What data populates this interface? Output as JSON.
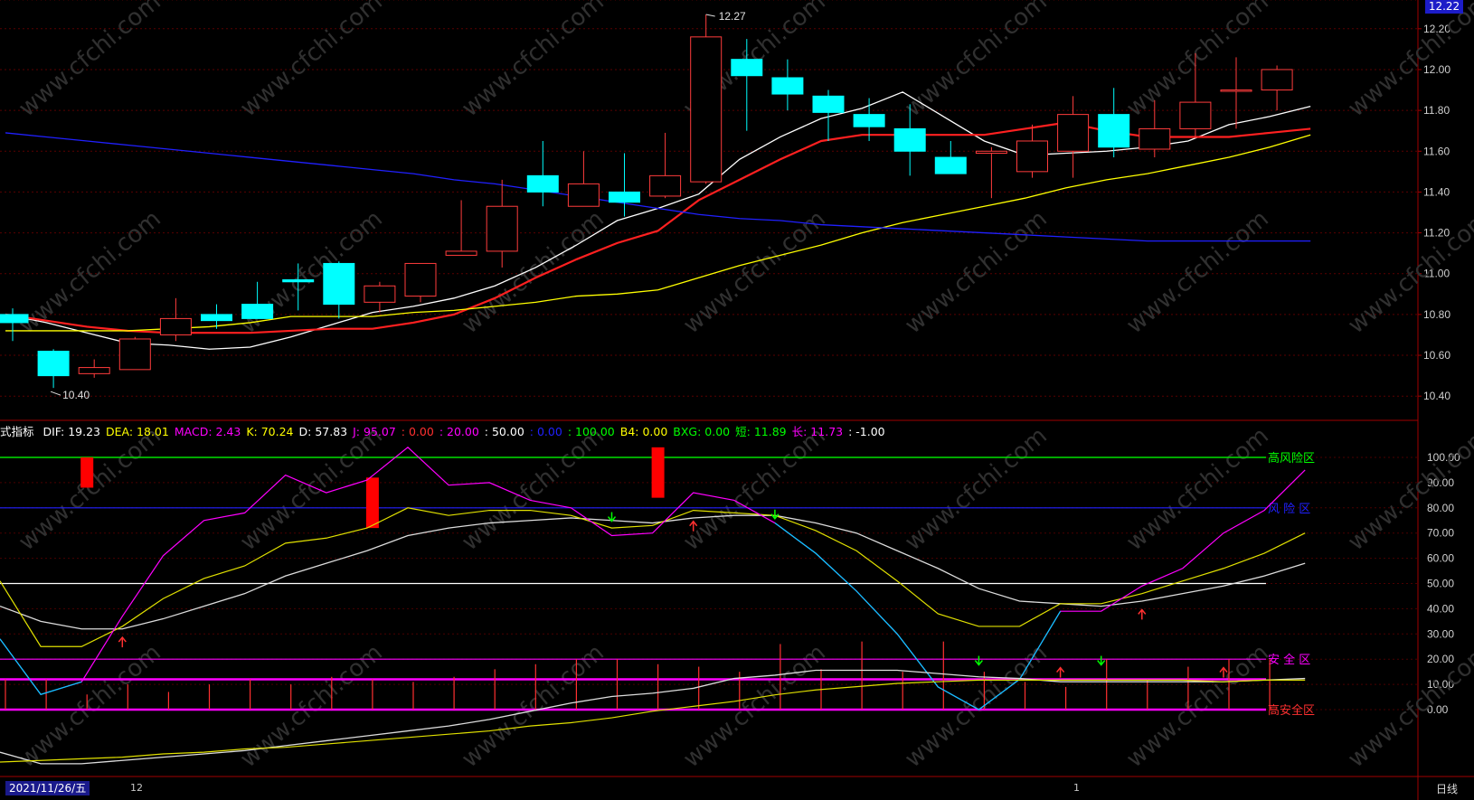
{
  "price_axis": {
    "last_price": "12.22",
    "ticks": [
      "12.20",
      "12.00",
      "11.80",
      "11.60",
      "11.40",
      "11.20",
      "11.00",
      "10.80",
      "10.60",
      "10.40"
    ]
  },
  "indicator_axis": {
    "ticks": [
      "100.00",
      "90.00",
      "80.00",
      "70.00",
      "60.00",
      "50.00",
      "40.00",
      "30.00",
      "20.00",
      "10.00",
      "0.00"
    ]
  },
  "annotations": {
    "high": "12.27",
    "low": "10.40"
  },
  "zones": {
    "high_risk": "高风险区",
    "risk": "风 险 区",
    "safe": "安 全 区",
    "super_safe": "高安全区"
  },
  "indicator_header": {
    "name": "式指标",
    "items": [
      {
        "text": "DIF: 19.23",
        "color": "#ffffff"
      },
      {
        "text": "DEA: 18.01",
        "color": "#ffff00"
      },
      {
        "text": "MACD: 2.43",
        "color": "#ff00ff"
      },
      {
        "text": "K: 70.24",
        "color": "#ffff00"
      },
      {
        "text": "D: 57.83",
        "color": "#ffffff"
      },
      {
        "text": "J: 95.07",
        "color": "#ff00ff"
      },
      {
        "text": ": 0.00",
        "color": "#ff3030"
      },
      {
        "text": ": 20.00",
        "color": "#ff00ff"
      },
      {
        "text": ": 50.00",
        "color": "#ffffff"
      },
      {
        "text": ": 0.00",
        "color": "#2020ff"
      },
      {
        "text": ": 100.00",
        "color": "#00ff00"
      },
      {
        "text": "B4: 0.00",
        "color": "#ffff00"
      },
      {
        "text": "BXG: 0.00",
        "color": "#00ff00"
      },
      {
        "text": "短: 11.89",
        "color": "#00ff00"
      },
      {
        "text": "长: 11.73",
        "color": "#ff00ff"
      },
      {
        "text": ": -1.00",
        "color": "#ffffff"
      }
    ]
  },
  "date_label": "2021/11/26/五",
  "tick_12": "12",
  "tick_1": "1",
  "period_label": "日线",
  "watermark": "www.cfchi.com",
  "colors": {
    "up": "#ff3c3c",
    "down": "#00ffff",
    "ma_short": "#ffffff",
    "ma_mid": "#ff2020",
    "ma_long": "#ffff00",
    "ma_xlong": "#2020ff"
  },
  "chart_data": {
    "type": "candlestick",
    "price_ylim": [
      10.33,
      12.27
    ],
    "candles": [
      {
        "o": 10.8,
        "h": 10.83,
        "l": 10.67,
        "c": 10.76
      },
      {
        "o": 10.62,
        "h": 10.63,
        "l": 10.44,
        "c": 10.5
      },
      {
        "o": 10.51,
        "h": 10.58,
        "l": 10.49,
        "c": 10.54
      },
      {
        "o": 10.53,
        "h": 10.69,
        "l": 10.53,
        "c": 10.68
      },
      {
        "o": 10.7,
        "h": 10.88,
        "l": 10.67,
        "c": 10.78
      },
      {
        "o": 10.8,
        "h": 10.85,
        "l": 10.73,
        "c": 10.77
      },
      {
        "o": 10.85,
        "h": 10.96,
        "l": 10.78,
        "c": 10.78
      },
      {
        "o": 10.97,
        "h": 11.05,
        "l": 10.82,
        "c": 10.96
      },
      {
        "o": 11.05,
        "h": 11.06,
        "l": 10.78,
        "c": 10.85
      },
      {
        "o": 10.86,
        "h": 10.96,
        "l": 10.81,
        "c": 10.94
      },
      {
        "o": 10.89,
        "h": 11.04,
        "l": 10.86,
        "c": 11.05
      },
      {
        "o": 11.09,
        "h": 11.36,
        "l": 11.09,
        "c": 11.11
      },
      {
        "o": 11.11,
        "h": 11.46,
        "l": 11.03,
        "c": 11.33
      },
      {
        "o": 11.48,
        "h": 11.65,
        "l": 11.33,
        "c": 11.4
      },
      {
        "o": 11.33,
        "h": 11.6,
        "l": 11.33,
        "c": 11.44
      },
      {
        "o": 11.4,
        "h": 11.59,
        "l": 11.28,
        "c": 11.35
      },
      {
        "o": 11.38,
        "h": 11.69,
        "l": 11.37,
        "c": 11.48
      },
      {
        "o": 11.45,
        "h": 12.27,
        "l": 11.44,
        "c": 12.16
      },
      {
        "o": 12.05,
        "h": 12.15,
        "l": 11.7,
        "c": 11.97
      },
      {
        "o": 11.96,
        "h": 12.05,
        "l": 11.8,
        "c": 11.88
      },
      {
        "o": 11.87,
        "h": 11.9,
        "l": 11.65,
        "c": 11.79
      },
      {
        "o": 11.78,
        "h": 11.86,
        "l": 11.65,
        "c": 11.72
      },
      {
        "o": 11.71,
        "h": 11.83,
        "l": 11.48,
        "c": 11.6
      },
      {
        "o": 11.57,
        "h": 11.65,
        "l": 11.49,
        "c": 11.49
      },
      {
        "o": 11.59,
        "h": 11.62,
        "l": 11.37,
        "c": 11.6
      },
      {
        "o": 11.5,
        "h": 11.73,
        "l": 11.47,
        "c": 11.65
      },
      {
        "o": 11.6,
        "h": 11.87,
        "l": 11.47,
        "c": 11.78
      },
      {
        "o": 11.78,
        "h": 11.91,
        "l": 11.57,
        "c": 11.62
      },
      {
        "o": 11.61,
        "h": 11.85,
        "l": 11.57,
        "c": 11.71
      },
      {
        "o": 11.71,
        "h": 12.08,
        "l": 11.67,
        "c": 11.84
      },
      {
        "o": 11.9,
        "h": 12.06,
        "l": 11.71,
        "c": 11.9
      },
      {
        "o": 11.9,
        "h": 12.02,
        "l": 11.8,
        "c": 12.0
      }
    ],
    "ma": [
      {
        "key": "ma_short",
        "values": [
          10.8,
          10.76,
          10.71,
          10.66,
          10.65,
          10.63,
          10.64,
          10.69,
          10.75,
          10.81,
          10.84,
          10.88,
          10.94,
          11.03,
          11.14,
          11.26,
          11.32,
          11.39,
          11.56,
          11.67,
          11.76,
          11.81,
          11.89,
          11.77,
          11.65,
          11.58,
          11.59,
          11.6,
          11.62,
          11.65,
          11.73,
          11.77,
          11.82
        ]
      },
      {
        "key": "ma_mid",
        "values": [
          10.8,
          10.77,
          10.74,
          10.72,
          10.71,
          10.71,
          10.71,
          10.72,
          10.73,
          10.73,
          10.76,
          10.8,
          10.88,
          10.98,
          11.07,
          11.15,
          11.21,
          11.36,
          11.46,
          11.56,
          11.65,
          11.68,
          11.68,
          11.68,
          11.68,
          11.71,
          11.74,
          11.7,
          11.67,
          11.67,
          11.67,
          11.69,
          11.71
        ]
      },
      {
        "key": "ma_long",
        "values": [
          10.72,
          10.72,
          10.72,
          10.72,
          10.73,
          10.74,
          10.76,
          10.79,
          10.79,
          10.79,
          10.81,
          10.82,
          10.84,
          10.86,
          10.89,
          10.9,
          10.92,
          10.98,
          11.04,
          11.09,
          11.14,
          11.2,
          11.25,
          11.29,
          11.33,
          11.37,
          11.42,
          11.46,
          11.49,
          11.53,
          11.57,
          11.62,
          11.68
        ]
      },
      {
        "key": "ma_xlong",
        "values": [
          11.69,
          11.67,
          11.65,
          11.63,
          11.61,
          11.59,
          11.57,
          11.55,
          11.53,
          11.51,
          11.49,
          11.46,
          11.44,
          11.41,
          11.38,
          11.35,
          11.32,
          11.29,
          11.27,
          11.26,
          11.24,
          11.23,
          11.22,
          11.21,
          11.2,
          11.19,
          11.18,
          11.17,
          11.16,
          11.16,
          11.16,
          11.16,
          11.16
        ]
      }
    ],
    "indicator_ylim": [
      0,
      110
    ],
    "zone_levels": {
      "high_risk": 100,
      "risk": 80,
      "mid": 50,
      "safe": 20,
      "support": 12,
      "super_safe": 0
    },
    "K": [
      51,
      25,
      25,
      33,
      44,
      52,
      57,
      66,
      68,
      72,
      80,
      77,
      79,
      79,
      77,
      72,
      73,
      79,
      78,
      77,
      71,
      63,
      51,
      38,
      33,
      33,
      42,
      42,
      46,
      51,
      56,
      62,
      70
    ],
    "D": [
      41,
      35,
      32,
      32,
      36,
      41,
      46,
      53,
      58,
      63,
      69,
      72,
      74,
      75,
      76,
      75,
      74,
      76,
      77,
      77,
      74,
      70,
      63,
      56,
      48,
      43,
      42,
      41,
      43,
      46,
      49,
      53,
      58
    ],
    "J": [
      28,
      6,
      11,
      37,
      61,
      75,
      78,
      93,
      86,
      91,
      104,
      89,
      90,
      83,
      80,
      69,
      70,
      86,
      83,
      74,
      62,
      47,
      30,
      9,
      0,
      12,
      39,
      39,
      49,
      56,
      70,
      79,
      95
    ],
    "DIF": [
      -26,
      -33,
      -33,
      -31,
      -29,
      -27,
      -25,
      -22,
      -19,
      -16,
      -13,
      -10,
      -6,
      -1,
      4,
      8,
      10,
      13,
      19,
      21,
      24,
      24,
      24,
      22,
      20,
      19,
      17,
      17,
      17,
      17,
      17,
      18,
      19
    ],
    "DEA": [
      -32,
      -31,
      -30,
      -29,
      -27,
      -26,
      -24,
      -23,
      -21,
      -19,
      -17,
      -15,
      -13,
      -10,
      -8,
      -5,
      -1,
      2,
      5,
      9,
      12,
      14,
      16,
      17,
      18,
      18,
      18,
      18,
      18,
      18,
      17,
      18,
      18
    ],
    "bars": [
      12,
      12,
      6,
      10,
      7,
      10,
      12,
      10,
      13,
      12,
      11,
      13,
      16,
      18,
      20,
      20,
      18,
      17,
      15,
      26,
      16,
      27,
      15,
      27,
      15,
      11,
      9,
      20,
      12,
      17,
      20,
      20,
      20
    ],
    "big_red_bars": [
      {
        "index": 2,
        "from": 100,
        "to": 88
      },
      {
        "index": 9,
        "from": 92,
        "to": 72
      },
      {
        "index": 16,
        "from": 104,
        "to": 84
      }
    ],
    "arrows": [
      {
        "index": 3,
        "value": 29,
        "dir": "up",
        "color": "#ff3030"
      },
      {
        "index": 15,
        "value": 74,
        "dir": "down",
        "color": "#00ff00"
      },
      {
        "index": 17,
        "value": 75,
        "dir": "up",
        "color": "#ff3030"
      },
      {
        "index": 19,
        "value": 75,
        "dir": "down",
        "color": "#00ff00"
      },
      {
        "index": 24,
        "value": 17,
        "dir": "down",
        "color": "#00ff00"
      },
      {
        "index": 26,
        "value": 17,
        "dir": "up",
        "color": "#ff3030"
      },
      {
        "index": 27,
        "value": 17,
        "dir": "down",
        "color": "#00ff00"
      },
      {
        "index": 28,
        "value": 40,
        "dir": "up",
        "color": "#ff3030"
      },
      {
        "index": 30,
        "value": 17,
        "dir": "up",
        "color": "#ff3030"
      }
    ]
  }
}
